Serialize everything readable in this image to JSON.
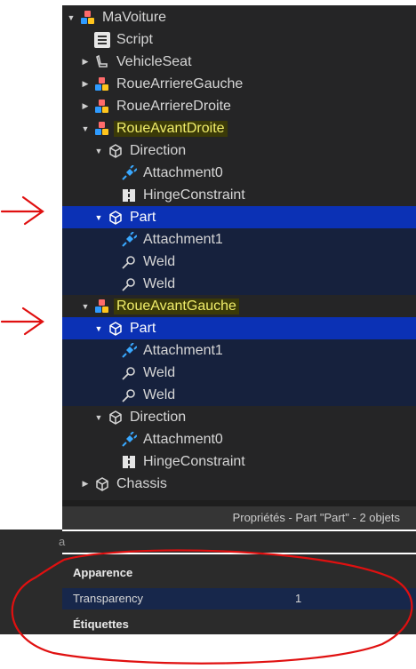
{
  "explorer": {
    "items": [
      {
        "label": "MaVoiture",
        "icon": "model-icon",
        "arrow": "expanded"
      },
      {
        "label": "Script",
        "icon": "script-icon",
        "arrow": "none"
      },
      {
        "label": "VehicleSeat",
        "icon": "seat-icon",
        "arrow": "collapsed"
      },
      {
        "label": "RoueArriereGauche",
        "icon": "model-icon",
        "arrow": "collapsed"
      },
      {
        "label": "RoueArriereDroite",
        "icon": "model-icon",
        "arrow": "collapsed"
      },
      {
        "label": "RoueAvantDroite",
        "icon": "model-icon",
        "arrow": "expanded",
        "highlighted": true
      },
      {
        "label": "Direction",
        "icon": "part-icon",
        "arrow": "expanded"
      },
      {
        "label": "Attachment0",
        "icon": "attachment-icon",
        "arrow": "none"
      },
      {
        "label": "HingeConstraint",
        "icon": "hinge-icon",
        "arrow": "none"
      },
      {
        "label": "Part",
        "icon": "part-icon",
        "arrow": "expanded",
        "selected": true
      },
      {
        "label": "Attachment1",
        "icon": "attachment-icon",
        "arrow": "none"
      },
      {
        "label": "Weld",
        "icon": "weld-icon",
        "arrow": "none"
      },
      {
        "label": "Weld",
        "icon": "weld-icon",
        "arrow": "none"
      },
      {
        "label": "RoueAvantGauche",
        "icon": "model-icon",
        "arrow": "expanded",
        "highlighted": true
      },
      {
        "label": "Part",
        "icon": "part-icon",
        "arrow": "expanded",
        "selected": true
      },
      {
        "label": "Attachment1",
        "icon": "attachment-icon",
        "arrow": "none"
      },
      {
        "label": "Weld",
        "icon": "weld-icon",
        "arrow": "none"
      },
      {
        "label": "Weld",
        "icon": "weld-icon",
        "arrow": "none"
      },
      {
        "label": "Direction",
        "icon": "part-icon",
        "arrow": "expanded"
      },
      {
        "label": "Attachment0",
        "icon": "attachment-icon",
        "arrow": "none"
      },
      {
        "label": "HingeConstraint",
        "icon": "hinge-icon",
        "arrow": "none"
      },
      {
        "label": "Chassis",
        "icon": "part-icon",
        "arrow": "collapsed"
      }
    ]
  },
  "properties": {
    "header": "Propriétés - Part \"Part\" - 2 objets",
    "filter_text": "a",
    "categories": {
      "appearance": "Apparence",
      "tags": "Étiquettes"
    },
    "rows": [
      {
        "name": "Transparency",
        "value": "1"
      }
    ]
  },
  "colors": {
    "selection": "#0b31b5",
    "highlight_text": "#f1ee6a",
    "annotation": "#e01010"
  }
}
